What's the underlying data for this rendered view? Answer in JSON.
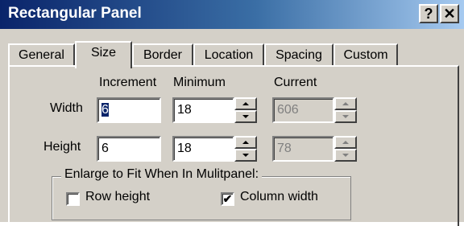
{
  "window": {
    "title": "Rectangular Panel",
    "help_label": "?",
    "close_label": "✕"
  },
  "tabs": [
    {
      "label": "General"
    },
    {
      "label": "Size"
    },
    {
      "label": "Border"
    },
    {
      "label": "Location"
    },
    {
      "label": "Spacing"
    },
    {
      "label": "Custom"
    }
  ],
  "active_tab": "Size",
  "columns": {
    "increment": "Increment",
    "minimum": "Minimum",
    "current": "Current"
  },
  "width": {
    "label": "Width",
    "increment": "6",
    "minimum": "18",
    "current": "606"
  },
  "height": {
    "label": "Height",
    "increment": "6",
    "minimum": "18",
    "current": "78"
  },
  "group": {
    "title": "Enlarge to Fit When In Mulitpanel:",
    "row_height": {
      "label": "Row height",
      "checked": false
    },
    "column_width": {
      "label": "Column width",
      "checked": true,
      "mark": "✔"
    }
  },
  "colors": {
    "dialog_bg": "#d4d0c8",
    "titlebar_start": "#0a246a",
    "titlebar_end": "#a6caf0",
    "selection": "#0a246a"
  }
}
